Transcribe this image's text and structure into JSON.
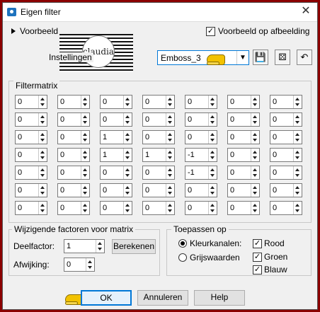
{
  "window": {
    "title": "Eigen filter"
  },
  "preview": {
    "label": "Voorbeeld",
    "check_label": "Voorbeeld op afbeelding",
    "checked": true
  },
  "logo": {
    "text": "claudia"
  },
  "settings": {
    "label": "Instellingen",
    "preset_value": "Emboss_3"
  },
  "matrix": {
    "label": "Filtermatrix",
    "rows": [
      [
        "0",
        "0",
        "0",
        "0",
        "0",
        "0",
        "0"
      ],
      [
        "0",
        "0",
        "0",
        "0",
        "0",
        "0",
        "0"
      ],
      [
        "0",
        "0",
        "1",
        "0",
        "0",
        "0",
        "0"
      ],
      [
        "0",
        "0",
        "1",
        "1",
        "-1",
        "0",
        "0"
      ],
      [
        "0",
        "0",
        "0",
        "0",
        "-1",
        "0",
        "0"
      ],
      [
        "0",
        "0",
        "0",
        "0",
        "0",
        "0",
        "0"
      ],
      [
        "0",
        "0",
        "0",
        "0",
        "0",
        "0",
        "0"
      ]
    ]
  },
  "factors": {
    "label": "Wijzigende factoren voor matrix",
    "divisor_label": "Deelfactor:",
    "divisor_value": "1",
    "calc_button": "Berekenen",
    "bias_label": "Afwijking:",
    "bias_value": "0"
  },
  "apply": {
    "label": "Toepassen op",
    "color_channels": "Kleurkanalen:",
    "grayscale": "Grijswaarden",
    "selected": "color_channels",
    "red": "Rood",
    "green": "Groen",
    "blue": "Blauw"
  },
  "buttons": {
    "ok": "OK",
    "cancel": "Annuleren",
    "help": "Help"
  },
  "colors": {
    "frame": "#8b0000",
    "ok_border": "#0078d7",
    "combo_border": "#0078d7",
    "pointer_hand": "#f2c200"
  }
}
